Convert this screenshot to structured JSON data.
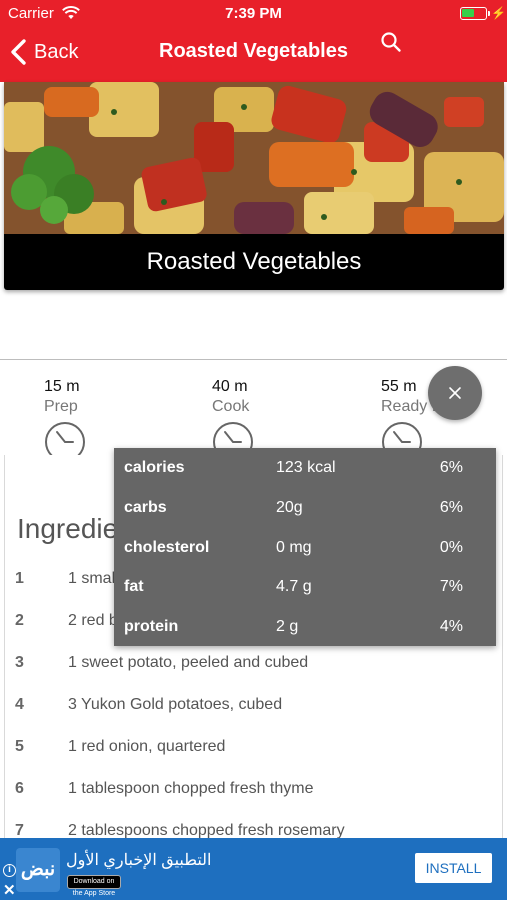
{
  "status_bar": {
    "carrier": "Carrier",
    "time": "7:39 PM"
  },
  "nav": {
    "back_label": "Back",
    "title": "Roasted Vegetables"
  },
  "hero": {
    "caption": "Roasted Vegetables"
  },
  "times": [
    {
      "value": "15 m",
      "label": "Prep"
    },
    {
      "value": "40 m",
      "label": "Cook"
    },
    {
      "value": "55 m",
      "label": "Ready In"
    }
  ],
  "ingredients": {
    "title": "Ingredients",
    "items": [
      {
        "num": "1",
        "text": "1 small butternut squash, cubed"
      },
      {
        "num": "2",
        "text": "2 red bell peppers, seeded and diced"
      },
      {
        "num": "3",
        "text": "1 sweet potato, peeled and cubed"
      },
      {
        "num": "4",
        "text": "3 Yukon Gold potatoes, cubed"
      },
      {
        "num": "5",
        "text": "1 red onion, quartered"
      },
      {
        "num": "6",
        "text": "1 tablespoon chopped fresh thyme"
      },
      {
        "num": "7",
        "text": "2 tablespoons chopped fresh rosemary"
      }
    ]
  },
  "nutrition": [
    {
      "name": "calories",
      "amount": "123 kcal",
      "percent": "6%"
    },
    {
      "name": "carbs",
      "amount": "20g",
      "percent": "6%"
    },
    {
      "name": "cholesterol",
      "amount": "0 mg",
      "percent": "0%"
    },
    {
      "name": "fat",
      "amount": "4.7 g",
      "percent": "7%"
    },
    {
      "name": "protein",
      "amount": "2 g",
      "percent": "4%"
    }
  ],
  "ad": {
    "logo_text": "نبض",
    "title": "التطبيق الإخباري الأول",
    "store_badge": "Download on the App Store",
    "install_label": "INSTALL",
    "info_glyph": "i",
    "close_glyph": "✕"
  },
  "colors": {
    "header": "#e8202a",
    "popup": "#666666",
    "ad": "#1e6fbf",
    "battery": "#35d04a"
  },
  "icons": [
    "wifi-icon",
    "battery-icon",
    "back-chevron-icon",
    "search-icon",
    "clock-icon",
    "close-icon",
    "info-icon"
  ]
}
